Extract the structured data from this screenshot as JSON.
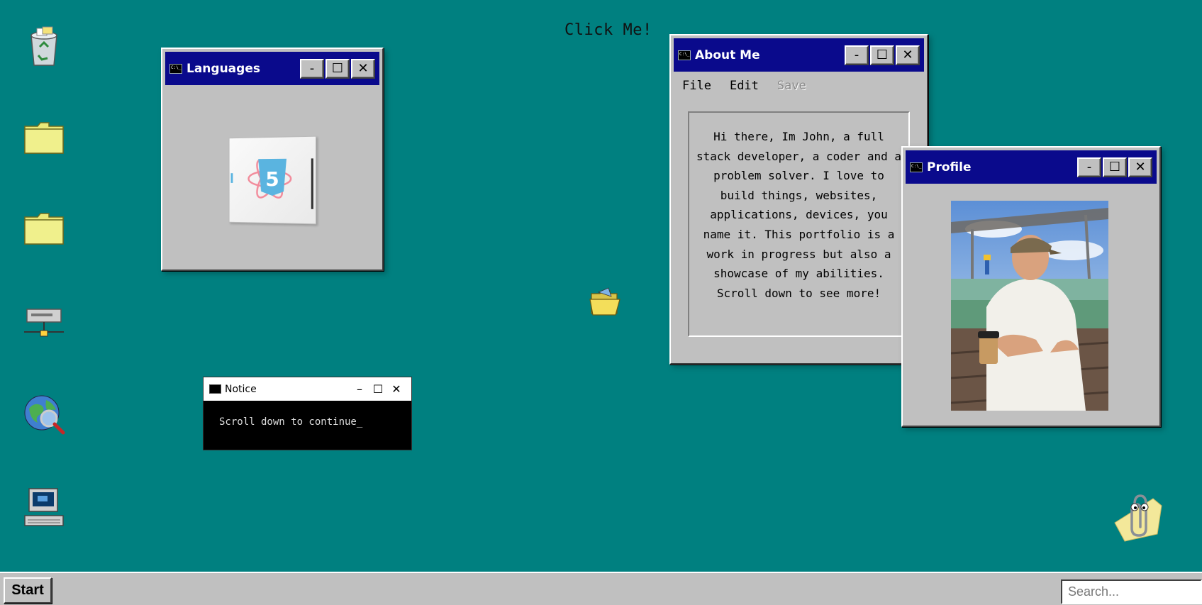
{
  "desktop": {
    "click_me": "Click Me!",
    "icons": [
      "recycle-bin-icon",
      "folder-icon",
      "folder-icon",
      "network-icon",
      "internet-search-icon",
      "my-computer-icon"
    ],
    "background_color": "#008080"
  },
  "languages_window": {
    "title": "Languages",
    "minimize": "-",
    "maximize": "☐",
    "close": "✕"
  },
  "about_window": {
    "title": "About Me",
    "menu": {
      "file": "File",
      "edit": "Edit",
      "save": "Save"
    },
    "text": "Hi there, Im John, a full stack developer, a coder and a problem solver. I love to build things, websites, applications, devices, you name it. This portfolio is a work in progress but also a showcase of my abilities. Scroll down to see more!",
    "minimize": "-",
    "maximize": "☐",
    "close": "✕"
  },
  "profile_window": {
    "title": "Profile",
    "minimize": "-",
    "maximize": "☐",
    "close": "✕"
  },
  "notice_window": {
    "title": "Notice",
    "body": "Scroll down to continue_",
    "minimize": "–",
    "maximize": "☐",
    "close": "✕"
  },
  "taskbar": {
    "start": "Start",
    "search_placeholder": "Search..."
  },
  "colors": {
    "titlebar": "#0a0a8c",
    "window": "#c0c0c0",
    "desktop": "#008080"
  }
}
